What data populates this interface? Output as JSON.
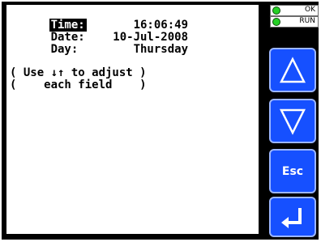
{
  "screen": {
    "rows": [
      {
        "label": "Time:",
        "value": "16:06:49"
      },
      {
        "label": "Date:",
        "value": "10-Jul-2008"
      },
      {
        "label": "Day:",
        "value": "Thursday"
      }
    ],
    "note_line1": "( Use ↓↑ to adjust )",
    "note_line2": "(    each field    )"
  },
  "indicators": [
    {
      "label": "OK",
      "color": "#26d126"
    },
    {
      "label": "RUN",
      "color": "#26d126"
    }
  ],
  "buttons": {
    "up_icon": "up-triangle-icon",
    "down_icon": "down-triangle-icon",
    "esc_label": "Esc",
    "enter_icon": "enter-arrow-icon"
  },
  "colors": {
    "button_blue": "#1650ff",
    "frame": "#000000",
    "screen_bg": "#ffffff"
  }
}
